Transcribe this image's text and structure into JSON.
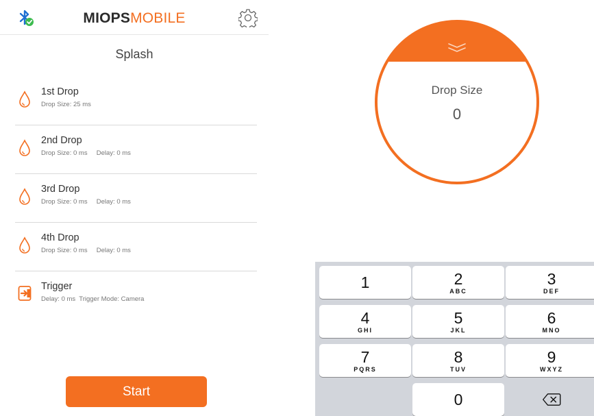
{
  "header": {
    "brand_bold": "MIOPS",
    "brand_light": "MOBILE",
    "icons": {
      "left": "bluetooth-connected-icon",
      "right": "gear-icon"
    }
  },
  "mode": {
    "title": "Splash"
  },
  "steps": [
    {
      "title": "1st Drop",
      "subtitle": "Drop Size: 25 ms",
      "icon": "drop-icon"
    },
    {
      "title": "2nd Drop",
      "subtitle": "Drop Size: 0 ms     Delay: 0 ms",
      "icon": "drop-icon"
    },
    {
      "title": "3rd Drop",
      "subtitle": "Drop Size: 0 ms     Delay: 0 ms",
      "icon": "drop-icon"
    },
    {
      "title": "4th Drop",
      "subtitle": "Drop Size: 0 ms     Delay: 0 ms",
      "icon": "drop-icon"
    },
    {
      "title": "Trigger",
      "subtitle": "Delay: 0 ms  Trigger Mode: Camera",
      "icon": "trigger-icon"
    }
  ],
  "start_button": {
    "label": "Start"
  },
  "dial": {
    "label": "Drop Size",
    "value": "0",
    "icon": "chevron-down-icon"
  },
  "keypad": {
    "keys": [
      {
        "num": "1",
        "letters": ""
      },
      {
        "num": "2",
        "letters": "ABC"
      },
      {
        "num": "3",
        "letters": "DEF"
      },
      {
        "num": "4",
        "letters": "GHI"
      },
      {
        "num": "5",
        "letters": "JKL"
      },
      {
        "num": "6",
        "letters": "MNO"
      },
      {
        "num": "7",
        "letters": "PQRS"
      },
      {
        "num": "8",
        "letters": "TUV"
      },
      {
        "num": "9",
        "letters": "WXYZ"
      },
      {
        "num": "0",
        "letters": ""
      }
    ],
    "delete_icon": "backspace-icon"
  },
  "colors": {
    "accent": "#f36f21",
    "keypad_bg": "#d2d5db",
    "bluetooth": "#1f6fd1",
    "check": "#3dbb4f"
  }
}
